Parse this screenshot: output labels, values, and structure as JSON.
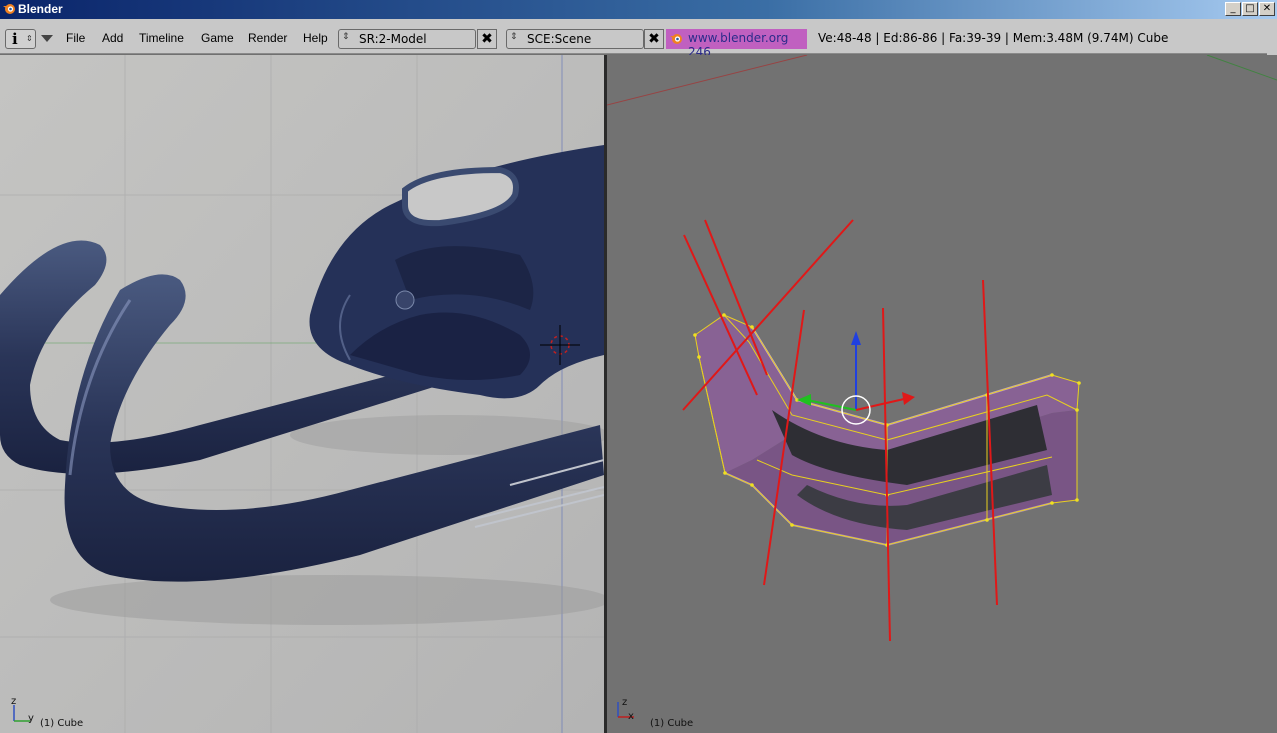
{
  "window": {
    "title": "Blender",
    "controls": {
      "minimize": "_",
      "maximize": "□",
      "close": "✕"
    }
  },
  "header": {
    "info_button": "i",
    "menu": [
      "File",
      "Add",
      "Timeline",
      "Game",
      "Render",
      "Help"
    ],
    "screen_field": "SR:2-Model",
    "scene_field": "SCE:Scene",
    "delete_symbol": "✖",
    "blender_url": "www.blender.org 246",
    "stats": "Ve:48-48 | Ed:86-86 | Fa:39-39 | Mem:3.48M (9.74M) Cube"
  },
  "left_viewport": {
    "axis_z": "z",
    "axis_y": "y",
    "object_label": "(1) Cube"
  },
  "right_viewport": {
    "axis_z": "z",
    "axis_x": "x",
    "object_label": "(1) Cube"
  },
  "colors": {
    "header_bg": "#c8c8c8",
    "left_view_bg": "#bcbcbc",
    "right_view_bg": "#727272",
    "mesh_fill": "#9a6aa6",
    "wire_yellow": "#e8d020",
    "guide_red": "#e01818",
    "url_bg": "#c060c0"
  },
  "icons": {
    "app": "blender-logo-icon",
    "spinner": "up-down-arrows-icon",
    "collapse": "triangle-down-icon"
  }
}
